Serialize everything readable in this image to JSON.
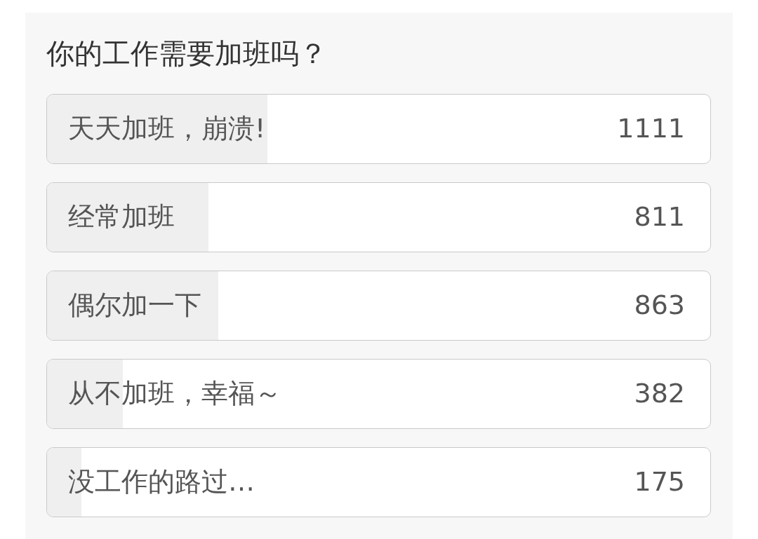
{
  "poll": {
    "question": "你的工作需要加班吗？",
    "options": [
      {
        "label": "天天加班，崩溃!",
        "count": "1111",
        "level": 0.332
      },
      {
        "label": "经常加班",
        "count": "811",
        "level": 0.243
      },
      {
        "label": "偶尔加一下",
        "count": "863",
        "level": 0.258
      },
      {
        "label": "从不加班，幸福～",
        "count": "382",
        "level": 0.114
      },
      {
        "label": "没工作的路过…",
        "count": "175",
        "level": 0.052
      }
    ]
  }
}
